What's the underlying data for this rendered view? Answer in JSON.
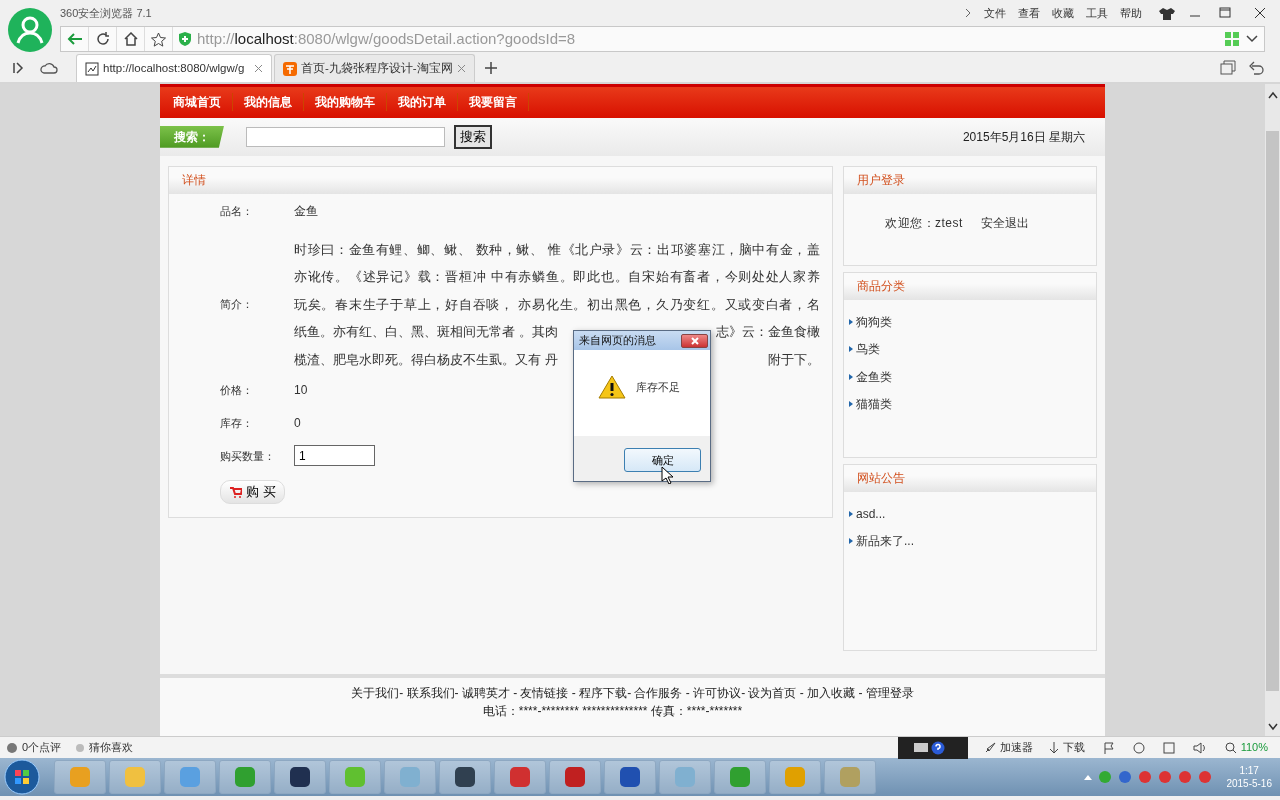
{
  "browser": {
    "title": "360安全浏览器 7.1",
    "menu": [
      "文件",
      "查看",
      "收藏",
      "工具",
      "帮助"
    ],
    "url": "http://**localhost**:8080/wlgw/goodsDetail.action?goodsId=8",
    "tabs": [
      {
        "label": "http://localhost:8080/wlgw/g",
        "selected": true,
        "kind": "page"
      },
      {
        "label": "首页-九袋张程序设计-淘宝网",
        "selected": false,
        "kind": "shop"
      }
    ]
  },
  "nav": [
    "商城首页",
    "我的信息",
    "我的购物车",
    "我的订单",
    "我要留言"
  ],
  "search": {
    "label": "搜索：",
    "button": "搜索",
    "date": "2015年5月16日 星期六"
  },
  "detail": {
    "title": "详情",
    "name_label": "品名：",
    "name": "金鱼",
    "intro_label": "简介：",
    "intro_lines": [
      [
        "时珍曰：金鱼有鲤、鲫、鳅、 数种，鳅、 惟《北户录》云：出邛婆塞江，脑中有金，盖"
      ],
      [
        "亦讹传。《述异记》载：晋桓冲 中有赤鳞鱼。即此也。自宋始有畜者，今则处处人家养"
      ],
      [
        "玩矣。春末生子于草上，好自吞啖， 亦易化生。初出黑色，久乃变红。又或变白者，名"
      ],
      [
        "纸鱼。亦有红、白、黑、斑相间无常者 。其肉",
        "志》云：金鱼食橄"
      ],
      [
        "榄渣、肥皂水即死。得白杨皮不生虱。又有 丹",
        "附于下。"
      ]
    ],
    "price_label": "价格：",
    "price": "10",
    "stock_label": "库存：",
    "stock": "0",
    "qty_label": "购买数量：",
    "qty": "1",
    "buy": "购 买"
  },
  "sidebar": [
    {
      "kind": "login",
      "title": "用户登录",
      "welcome": "欢迎您：ztest",
      "logout": "安全退出"
    },
    {
      "kind": "list",
      "title": "商品分类",
      "items": [
        "狗狗类",
        "鸟类",
        "金鱼类",
        "猫猫类"
      ]
    },
    {
      "kind": "list",
      "title": "网站公告",
      "items": [
        "asd...",
        "新品来了..."
      ]
    }
  ],
  "footer": {
    "links": "关于我们- 联系我们- 诚聘英才 - 友情链接 - 程序下载- 合作服务 - 许可协议- 设为首页 - 加入收藏 - 管理登录",
    "contact": "电话：****-******** ************** 传真：****-*******"
  },
  "dialog": {
    "title": "来自网页的消息",
    "message": "库存不足",
    "ok": "确定"
  },
  "status_bar": {
    "left": [
      "0个点评",
      "猜你喜欢"
    ],
    "accelerator": "加速器",
    "download": "下载",
    "zoom": "110%"
  },
  "taskbar": {
    "time": "1:17",
    "date": "2015-5-16"
  }
}
